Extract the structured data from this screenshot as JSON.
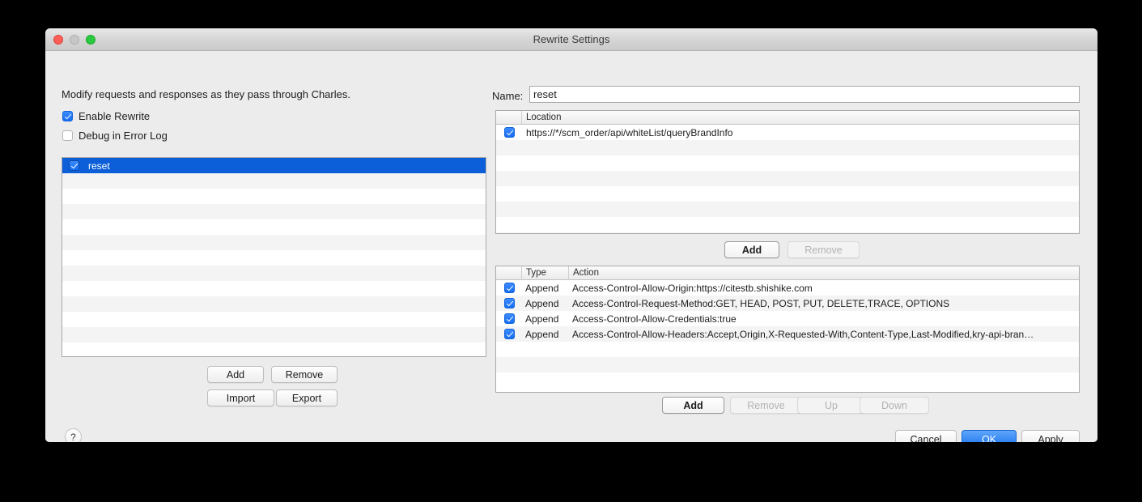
{
  "window": {
    "title": "Rewrite Settings",
    "traffic_lights": [
      "close",
      "minimize",
      "zoom"
    ]
  },
  "left": {
    "intro_text": "Modify requests and responses as they pass through Charles.",
    "options": [
      {
        "label": "Enable Rewrite",
        "checked": true
      },
      {
        "label": "Debug in Error Log",
        "checked": false
      }
    ],
    "rules": [
      {
        "label": "reset",
        "checked": true,
        "selected": true
      }
    ],
    "buttons": {
      "add": "Add",
      "remove": "Remove",
      "import": "Import",
      "export": "Export"
    },
    "help_glyph": "?"
  },
  "right": {
    "name_label": "Name:",
    "name_value": "reset",
    "location_table": {
      "columns": [
        "",
        "Location"
      ],
      "rows": [
        {
          "checked": true,
          "location": "https://*/scm_order/api/whiteList/queryBrandInfo"
        }
      ]
    },
    "location_buttons": {
      "add": "Add",
      "remove": "Remove"
    },
    "action_table": {
      "columns": [
        "",
        "Type",
        "Action"
      ],
      "rows": [
        {
          "checked": true,
          "type": "Append",
          "action": "Access-Control-Allow-Origin:https://citestb.shishike.com"
        },
        {
          "checked": true,
          "type": "Append",
          "action": "Access-Control-Request-Method:GET, HEAD, POST, PUT, DELETE,TRACE, OPTIONS"
        },
        {
          "checked": true,
          "type": "Append",
          "action": "Access-Control-Allow-Credentials:true"
        },
        {
          "checked": true,
          "type": "Append",
          "action": "Access-Control-Allow-Headers:Accept,Origin,X-Requested-With,Content-Type,Last-Modified,kry-api-bran…"
        }
      ]
    },
    "action_buttons": {
      "add": "Add",
      "remove": "Remove",
      "up": "Up",
      "down": "Down"
    }
  },
  "footer": {
    "cancel": "Cancel",
    "ok": "OK",
    "apply": "Apply"
  },
  "colors": {
    "selection_blue": "#0c5fd8",
    "checkbox_blue": "#166ef1",
    "default_button_blue": "#1a71ee",
    "window_bg": "#ececec",
    "page_bg": "#000000"
  }
}
